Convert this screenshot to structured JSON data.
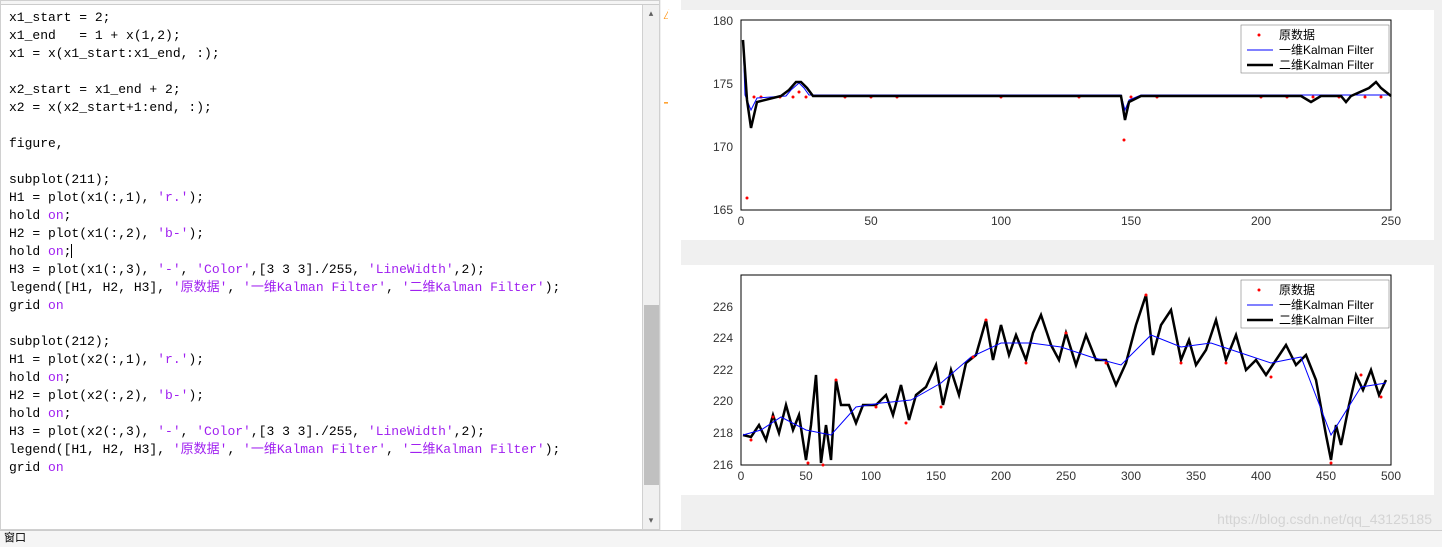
{
  "editor": {
    "lines": [
      {
        "type": "code",
        "tokens": [
          {
            "t": "x1_start = 2;",
            "c": ""
          }
        ]
      },
      {
        "type": "code",
        "tokens": [
          {
            "t": "x1_end   = 1 + x(1,2);",
            "c": ""
          }
        ]
      },
      {
        "type": "code",
        "tokens": [
          {
            "t": "x1 = x(x1_start:x1_end, :);",
            "c": ""
          }
        ]
      },
      {
        "type": "blank"
      },
      {
        "type": "code",
        "tokens": [
          {
            "t": "x2_start = x1_end + 2;",
            "c": ""
          }
        ]
      },
      {
        "type": "code",
        "tokens": [
          {
            "t": "x2 = x(x2_start+1:end, :);",
            "c": ""
          }
        ]
      },
      {
        "type": "blank"
      },
      {
        "type": "code",
        "tokens": [
          {
            "t": "figure,",
            "c": ""
          }
        ]
      },
      {
        "type": "blank"
      },
      {
        "type": "code",
        "tokens": [
          {
            "t": "subplot(211);",
            "c": ""
          }
        ]
      },
      {
        "type": "code",
        "tokens": [
          {
            "t": "H1 = plot(x1(:,1), ",
            "c": ""
          },
          {
            "t": "'r.'",
            "c": "str-purple"
          },
          {
            "t": ");",
            "c": ""
          }
        ]
      },
      {
        "type": "code",
        "tokens": [
          {
            "t": "hold ",
            "c": ""
          },
          {
            "t": "on",
            "c": "str-purple"
          },
          {
            "t": ";",
            "c": ""
          }
        ]
      },
      {
        "type": "code",
        "tokens": [
          {
            "t": "H2 = plot(x1(:,2), ",
            "c": ""
          },
          {
            "t": "'b-'",
            "c": "str-purple"
          },
          {
            "t": ");",
            "c": ""
          }
        ]
      },
      {
        "type": "code",
        "tokens": [
          {
            "t": "hold ",
            "c": ""
          },
          {
            "t": "on",
            "c": "str-purple"
          },
          {
            "t": ";",
            "c": ""
          }
        ],
        "cursor": true
      },
      {
        "type": "code",
        "tokens": [
          {
            "t": "H3 = plot(x1(:,3), ",
            "c": ""
          },
          {
            "t": "'-'",
            "c": "str-purple"
          },
          {
            "t": ", ",
            "c": ""
          },
          {
            "t": "'Color'",
            "c": "str-purple"
          },
          {
            "t": ",[3 3 3]./255, ",
            "c": ""
          },
          {
            "t": "'LineWidth'",
            "c": "str-purple"
          },
          {
            "t": ",2);",
            "c": ""
          }
        ]
      },
      {
        "type": "code",
        "tokens": [
          {
            "t": "legend([H1, H2, H3], ",
            "c": ""
          },
          {
            "t": "'原数据'",
            "c": "str-purple"
          },
          {
            "t": ", ",
            "c": ""
          },
          {
            "t": "'一维Kalman Filter'",
            "c": "str-purple"
          },
          {
            "t": ", ",
            "c": ""
          },
          {
            "t": "'二维Kalman Filter'",
            "c": "str-purple"
          },
          {
            "t": ");",
            "c": ""
          }
        ]
      },
      {
        "type": "code",
        "tokens": [
          {
            "t": "grid ",
            "c": ""
          },
          {
            "t": "on",
            "c": "str-purple"
          }
        ]
      },
      {
        "type": "blank"
      },
      {
        "type": "code",
        "tokens": [
          {
            "t": "subplot(212);",
            "c": ""
          }
        ]
      },
      {
        "type": "code",
        "tokens": [
          {
            "t": "H1 = plot(x2(:,1), ",
            "c": ""
          },
          {
            "t": "'r.'",
            "c": "str-purple"
          },
          {
            "t": ");",
            "c": ""
          }
        ]
      },
      {
        "type": "code",
        "tokens": [
          {
            "t": "hold ",
            "c": ""
          },
          {
            "t": "on",
            "c": "str-purple"
          },
          {
            "t": ";",
            "c": ""
          }
        ]
      },
      {
        "type": "code",
        "tokens": [
          {
            "t": "H2 = plot(x2(:,2), ",
            "c": ""
          },
          {
            "t": "'b-'",
            "c": "str-purple"
          },
          {
            "t": ");",
            "c": ""
          }
        ]
      },
      {
        "type": "code",
        "tokens": [
          {
            "t": "hold ",
            "c": ""
          },
          {
            "t": "on",
            "c": "str-purple"
          },
          {
            "t": ";",
            "c": ""
          }
        ]
      },
      {
        "type": "code",
        "tokens": [
          {
            "t": "H3 = plot(x2(:,3), ",
            "c": ""
          },
          {
            "t": "'-'",
            "c": "str-purple"
          },
          {
            "t": ", ",
            "c": ""
          },
          {
            "t": "'Color'",
            "c": "str-purple"
          },
          {
            "t": ",[3 3 3]./255, ",
            "c": ""
          },
          {
            "t": "'LineWidth'",
            "c": "str-purple"
          },
          {
            "t": ",2);",
            "c": ""
          }
        ]
      },
      {
        "type": "code",
        "tokens": [
          {
            "t": "legend([H1, H2, H3], ",
            "c": ""
          },
          {
            "t": "'原数据'",
            "c": "str-purple"
          },
          {
            "t": ", ",
            "c": ""
          },
          {
            "t": "'一维Kalman Filter'",
            "c": "str-purple"
          },
          {
            "t": ", ",
            "c": ""
          },
          {
            "t": "'二维Kalman Filter'",
            "c": "str-purple"
          },
          {
            "t": ");",
            "c": ""
          }
        ]
      },
      {
        "type": "code",
        "tokens": [
          {
            "t": "grid ",
            "c": ""
          },
          {
            "t": "on",
            "c": "str-purple"
          }
        ]
      }
    ]
  },
  "status_bar": {
    "text": "窗口"
  },
  "watermark": "https://blog.csdn.net/qq_43125185",
  "chart_data": [
    {
      "type": "line",
      "xlim": [
        0,
        250
      ],
      "ylim": [
        165,
        180
      ],
      "xticks": [
        0,
        50,
        100,
        150,
        200,
        250
      ],
      "yticks": [
        165,
        170,
        175,
        180
      ],
      "legend": {
        "entries": [
          "原数据",
          "一维Kalman Filter",
          "二维Kalman Filter"
        ],
        "position": "top-right"
      },
      "series": [
        {
          "name": "原数据",
          "style": "r.",
          "x": [
            2,
            5,
            8,
            10,
            15,
            20,
            25,
            30,
            40,
            50,
            60,
            70,
            80,
            90,
            100,
            110,
            120,
            130,
            140,
            148,
            155,
            160,
            170,
            180,
            190,
            200,
            210,
            215,
            220,
            225,
            228,
            230,
            235,
            238,
            240
          ],
          "y": [
            166,
            174,
            174,
            174,
            174,
            174,
            175,
            174,
            174,
            174,
            174,
            174,
            174,
            174,
            174,
            174,
            174,
            174,
            174,
            170.5,
            174,
            174,
            174,
            174,
            174,
            174,
            174,
            174,
            174,
            174,
            174,
            174,
            174,
            174,
            174
          ]
        },
        {
          "name": "一维Kalman Filter",
          "style": "b-",
          "path": "approx_filter1_top"
        },
        {
          "name": "二维Kalman Filter",
          "style": "k-",
          "path": "approx_filter2_top"
        }
      ]
    },
    {
      "type": "line",
      "xlim": [
        0,
        500
      ],
      "ylim": [
        216,
        228
      ],
      "xticks": [
        0,
        50,
        100,
        150,
        200,
        250,
        300,
        350,
        400,
        450,
        500
      ],
      "yticks": [
        216,
        218,
        220,
        222,
        224,
        226
      ],
      "legend": {
        "entries": [
          "原数据",
          "一维Kalman Filter",
          "二维Kalman Filter"
        ],
        "position": "top-right"
      },
      "series": [
        {
          "name": "原数据",
          "style": "r.",
          "note": "scattered noisy data ~216-227"
        },
        {
          "name": "一维Kalman Filter",
          "style": "b-",
          "note": "smoothed blue trace"
        },
        {
          "name": "二维Kalman Filter",
          "style": "k-",
          "note": "thick black trace mostly overlapping"
        }
      ]
    }
  ]
}
